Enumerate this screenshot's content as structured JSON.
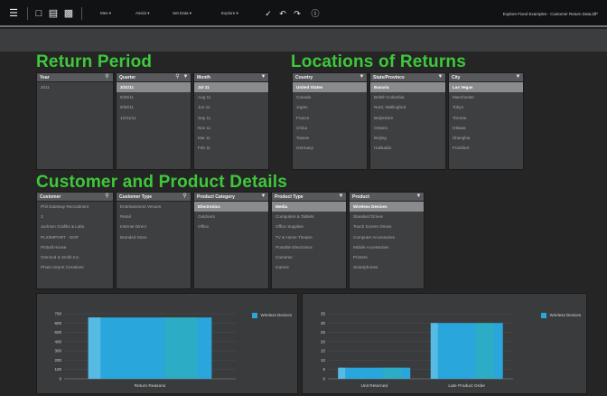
{
  "toolbar": {
    "menus": [
      "Mes",
      "Assist",
      "Set Data",
      "Explore"
    ],
    "title": "Explore Fixed Examples - Customer Return Data.ldf*"
  },
  "sections": {
    "return_period": "Return Period",
    "locations": "Locations of Returns",
    "customer_product": "Customer and Product Details"
  },
  "listboxes": {
    "year": {
      "label": "Year",
      "items": [
        "2011"
      ]
    },
    "quarter": {
      "label": "Quarter",
      "items": [
        "3/31/11",
        "6/30/11",
        "9/30/11",
        "12/31/11"
      ]
    },
    "month": {
      "label": "Month",
      "items": [
        "Jul 11",
        "Aug 11",
        "Jun 11",
        "Sep 11",
        "Nov 11",
        "Mar 11",
        "Feb 11"
      ]
    },
    "country": {
      "label": "Country",
      "items": [
        "United States",
        "Canada",
        "Japan",
        "France",
        "China",
        "Taiwan",
        "Germany"
      ]
    },
    "state": {
      "label": "State/Province",
      "items": [
        "Bavaria",
        "British Columbia",
        "Nord, Wallingford",
        "Beijinshire",
        "Ontario",
        "Beijing",
        "Hokkaido"
      ]
    },
    "city": {
      "label": "City",
      "items": [
        "Las Vegas",
        "Manchester",
        "Tokyo",
        "Toronto",
        "Ottawa",
        "Shanghai",
        "Frankfurt"
      ]
    },
    "customer": {
      "label": "Customer",
      "items": [
        "Phil Gateway Recruitment",
        "3",
        "Jackson Grafiks & Labs",
        "PLX/IMPORT - GOP",
        "Pinball House",
        "Osmond & Smith Inc.",
        "Photo Airport Creations"
      ]
    },
    "customer_type": {
      "label": "Customer Type",
      "items": [
        "Entertainment Venues",
        "Retail",
        "Internet Direct",
        "Branded Store"
      ]
    },
    "product_category": {
      "label": "Product Category",
      "items": [
        "Electronics",
        "Outdoors",
        "Office"
      ]
    },
    "product_type": {
      "label": "Product Type",
      "items": [
        "Media",
        "Computers & Tablets",
        "Office Supplies",
        "TV & Home Theatre",
        "Portable Electronics",
        "Cameras",
        "Games"
      ]
    },
    "product": {
      "label": "Product",
      "items": [
        "Wireless Devices",
        "Standard Drives",
        "Touch Screen Drives",
        "Computer Accessories",
        "Mobile Accessories",
        "Printers",
        "Smartphones"
      ]
    }
  },
  "colors": {
    "accent_green": "#3ec83a",
    "bar_blue": "#29a6dc"
  },
  "chart_data": [
    {
      "type": "bar",
      "categories": [
        "Return Reasons"
      ],
      "series": [
        {
          "name": "Wireless Devices",
          "values": [
            660
          ]
        }
      ],
      "ylim": [
        0,
        700
      ],
      "yticks": [
        0,
        100,
        200,
        300,
        400,
        500,
        600,
        700
      ],
      "xlabel": "",
      "ylabel": "",
      "legend": "top-right",
      "grid": true
    },
    {
      "type": "bar",
      "categories": [
        "Unit Returned",
        "Late Product Order"
      ],
      "series": [
        {
          "name": "Wireless Devices",
          "values": [
            6,
            30
          ]
        }
      ],
      "ylim": [
        0,
        35
      ],
      "yticks": [
        0,
        5,
        10,
        15,
        20,
        25,
        30,
        35
      ],
      "xlabel": "",
      "ylabel": "",
      "legend": "top-right",
      "grid": true
    }
  ]
}
